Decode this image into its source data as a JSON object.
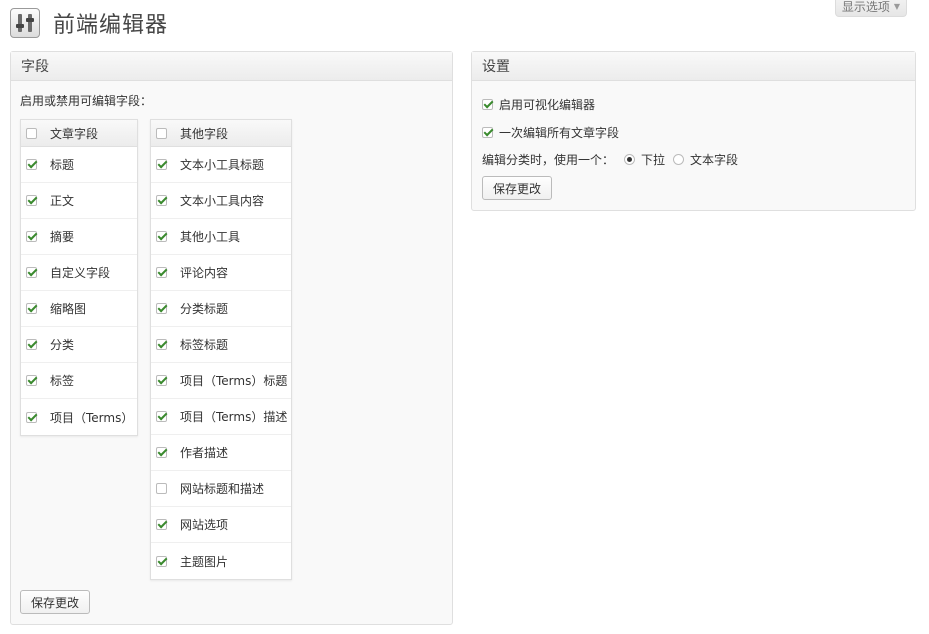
{
  "page": {
    "title": "前端编辑器"
  },
  "screen_options": {
    "label": "显示选项"
  },
  "fields_panel": {
    "title": "字段",
    "intro": "启用或禁用可编辑字段：",
    "left_table": {
      "header": "文章字段",
      "header_checked": false,
      "rows": [
        {
          "label": "标题",
          "checked": true
        },
        {
          "label": "正文",
          "checked": true
        },
        {
          "label": "摘要",
          "checked": true
        },
        {
          "label": "自定义字段",
          "checked": true
        },
        {
          "label": "缩略图",
          "checked": true
        },
        {
          "label": "分类",
          "checked": true
        },
        {
          "label": "标签",
          "checked": true
        },
        {
          "label": "项目（Terms）",
          "checked": true
        }
      ]
    },
    "right_table": {
      "header": "其他字段",
      "header_checked": false,
      "rows": [
        {
          "label": "文本小工具标题",
          "checked": true
        },
        {
          "label": "文本小工具内容",
          "checked": true
        },
        {
          "label": "其他小工具",
          "checked": true
        },
        {
          "label": "评论内容",
          "checked": true
        },
        {
          "label": "分类标题",
          "checked": true
        },
        {
          "label": "标签标题",
          "checked": true
        },
        {
          "label": "项目（Terms）标题",
          "checked": true
        },
        {
          "label": "项目（Terms）描述",
          "checked": true
        },
        {
          "label": "作者描述",
          "checked": true
        },
        {
          "label": "网站标题和描述",
          "checked": false
        },
        {
          "label": "网站选项",
          "checked": true
        },
        {
          "label": "主题图片",
          "checked": true
        }
      ]
    },
    "save_label": "保存更改"
  },
  "settings_panel": {
    "title": "设置",
    "rich_editor": {
      "label": "启用可视化编辑器",
      "checked": true
    },
    "group_edit": {
      "label": "一次编辑所有文章字段",
      "checked": true
    },
    "taxonomy": {
      "label": "编辑分类时，使用一个：",
      "options": [
        {
          "label": "下拉",
          "selected": true
        },
        {
          "label": "文本字段",
          "selected": false
        }
      ]
    },
    "save_label": "保存更改"
  }
}
